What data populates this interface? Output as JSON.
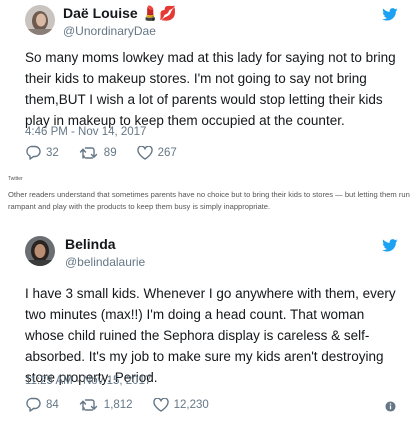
{
  "tweets": [
    {
      "name": "Daë Louise 💄💋",
      "handle": "@UnordinaryDae",
      "text": "So many moms lowkey mad at this lady for saying not to bring their kids to makeup stores. I'm not going to say not bring them,BUT I wish a lot of parents would stop letting their kids play in makeup to keep them occupied at the counter.",
      "time": "4:46 PM - Nov 14, 2017",
      "replies": "32",
      "retweets": "89",
      "likes": "267",
      "icons": {
        "brand": "twitter-bird-icon",
        "reply": "reply-icon",
        "retweet": "retweet-icon",
        "like": "heart-icon"
      }
    },
    {
      "name": "Belinda",
      "handle": "@belindalaurie",
      "text": "I have 3 small kids. Whenever I go anywhere with them, every two minutes (max!!) I'm doing a head count. That woman whose child ruined the Sephora display is careless & self-absorbed. It's my job to make sure my kids aren't destroying store property. Period.",
      "time": "11:25 AM - Nov 15, 2017",
      "replies": "84",
      "retweets": "1,812",
      "likes": "12,230",
      "icons": {
        "brand": "twitter-bird-icon",
        "reply": "reply-icon",
        "retweet": "retweet-icon",
        "like": "heart-icon",
        "info": "info-icon"
      }
    }
  ],
  "caption": {
    "label": "Twitter",
    "text": "Other readers understand that sometimes parents have no choice but to bring their kids to stores — but letting them run rampant and play with the products to keep them busy is simply inappropriate."
  },
  "colors": {
    "twitter_blue": "#1da1f2",
    "text": "#14171a",
    "secondary": "#657786"
  }
}
